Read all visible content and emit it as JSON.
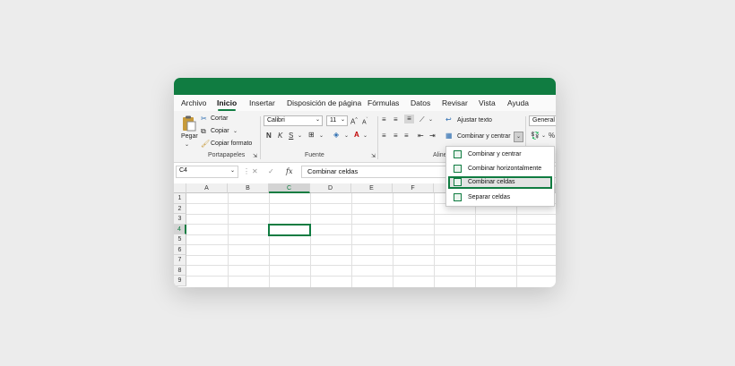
{
  "colors": {
    "accent": "#107c41",
    "ribbon_bg": "#f3f3f3",
    "page_bg": "#ececec"
  },
  "tabs": [
    {
      "label": "Archivo"
    },
    {
      "label": "Inicio"
    },
    {
      "label": "Insertar"
    },
    {
      "label": "Disposición de página"
    },
    {
      "label": "Fórmulas"
    },
    {
      "label": "Datos"
    },
    {
      "label": "Revisar"
    },
    {
      "label": "Vista"
    },
    {
      "label": "Ayuda"
    }
  ],
  "active_tab": "Inicio",
  "ribbon": {
    "clipboard": {
      "paste": "Pegar",
      "cut": "Cortar",
      "copy": "Copiar",
      "format_painter": "Copiar formato",
      "label": "Portapapeles"
    },
    "font": {
      "family": "Calibri",
      "size": "11",
      "bold": "N",
      "italic": "K",
      "underline": "S",
      "label": "Fuente"
    },
    "alignment": {
      "wrap_text": "Ajustar texto",
      "merge_center": "Combinar y centrar",
      "label": "Aline"
    },
    "number": {
      "format": "General"
    }
  },
  "formula_bar": {
    "name_box": "C4",
    "formula": "Combinar celdas"
  },
  "grid": {
    "columns": [
      "A",
      "B",
      "C",
      "D",
      "E",
      "F"
    ],
    "rows": [
      "1",
      "2",
      "3",
      "4",
      "5",
      "6",
      "7",
      "8",
      "9"
    ],
    "selected_cell": "C4"
  },
  "merge_menu": {
    "items": [
      {
        "label": "Combinar y centrar"
      },
      {
        "label": "Combinar horizontalmente"
      },
      {
        "label": "Combinar celdas"
      },
      {
        "label": "Separar celdas"
      }
    ],
    "highlighted": "Combinar celdas"
  }
}
